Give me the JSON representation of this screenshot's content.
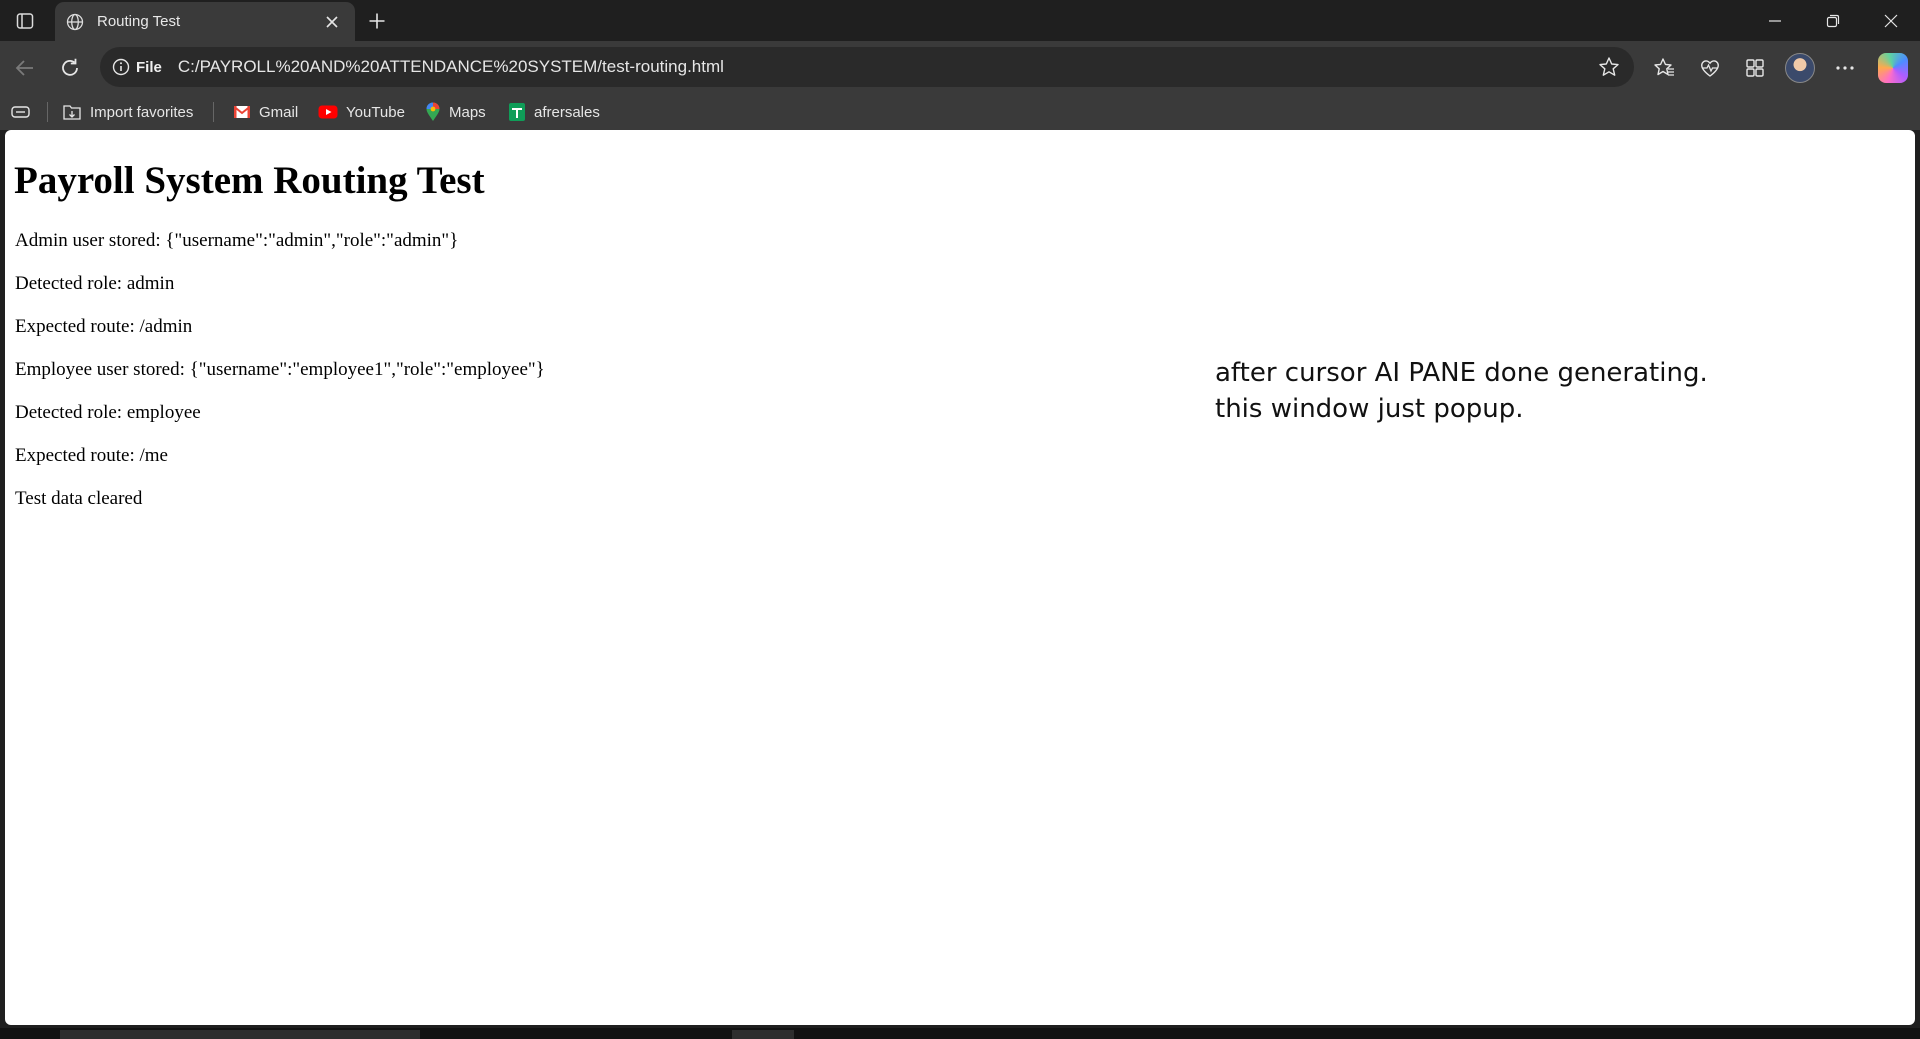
{
  "tab": {
    "title": "Routing Test"
  },
  "address_bar": {
    "site_info_label": "File",
    "url": "C:/PAYROLL%20AND%20ATTENDANCE%20SYSTEM/test-routing.html"
  },
  "favorites": [
    {
      "label": "Import favorites",
      "icon": "import-icon"
    },
    {
      "label": "Gmail",
      "icon": "gmail-icon"
    },
    {
      "label": "YouTube",
      "icon": "youtube-icon"
    },
    {
      "label": "Maps",
      "icon": "maps-icon"
    },
    {
      "label": "afrersales",
      "icon": "sheets-icon"
    }
  ],
  "page": {
    "heading": "Payroll System Routing Test",
    "lines": [
      "Admin user stored: {\"username\":\"admin\",\"role\":\"admin\"}",
      "Detected role: admin",
      "Expected route: /admin",
      "Employee user stored: {\"username\":\"employee1\",\"role\":\"employee\"}",
      "Detected role: employee",
      "Expected route: /me",
      "Test data cleared"
    ]
  },
  "annotation": {
    "line1": "after cursor AI PANE done generating.",
    "line2": "this window just popup."
  },
  "colors": {
    "chrome_dark": "#1f1f1f",
    "chrome": "#3a3a3a",
    "page_bg": "#ffffff",
    "youtube_red": "#ff0000",
    "sheets_green": "#0f9d58"
  }
}
